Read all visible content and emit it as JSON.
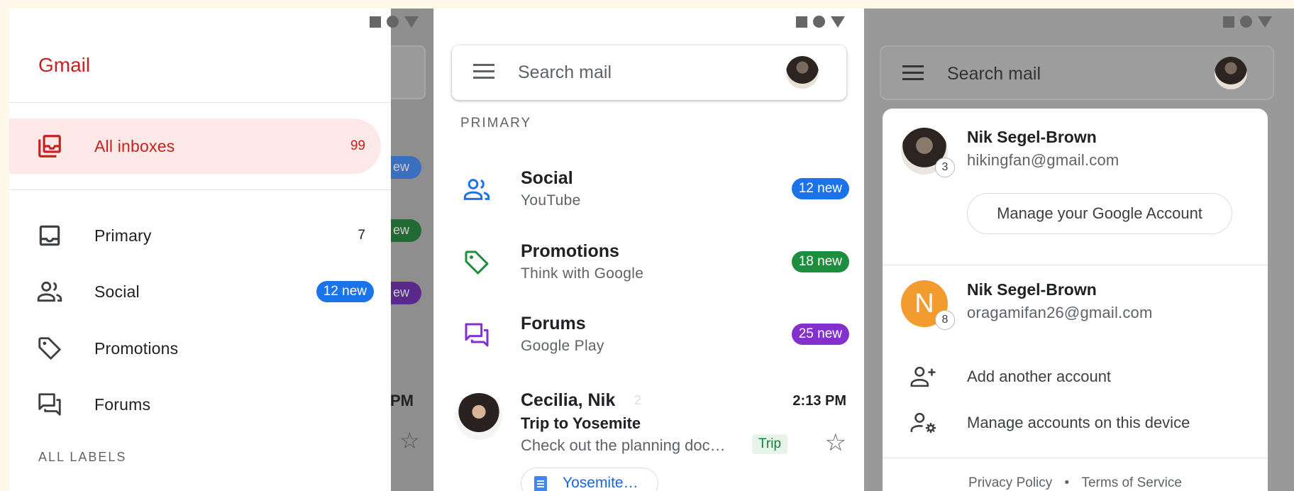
{
  "drawer": {
    "brand": "Gmail",
    "items": [
      {
        "label": "All inboxes",
        "count": "99"
      },
      {
        "label": "Primary",
        "count": "7"
      },
      {
        "label": "Social",
        "badge": "12 new"
      },
      {
        "label": "Promotions"
      },
      {
        "label": "Forums"
      }
    ],
    "all_labels": "ALL LABELS",
    "background_fragments": {
      "badge1": "ew",
      "badge2": "ew",
      "badge3": "ew",
      "time": "PM"
    }
  },
  "inbox": {
    "search_placeholder": "Search mail",
    "section": "PRIMARY",
    "categories": [
      {
        "title": "Social",
        "subtitle": "YouTube",
        "badge": "12 new",
        "color": "#1a73e8"
      },
      {
        "title": "Promotions",
        "subtitle": "Think with Google",
        "badge": "18 new",
        "color": "#1e8e3e"
      },
      {
        "title": "Forums",
        "subtitle": "Google Play",
        "badge": "25 new",
        "color": "#8430ce"
      }
    ],
    "message": {
      "sender": "Cecilia, Nik",
      "thread_count": "2",
      "time": "2:13 PM",
      "subject": "Trip to Yosemite",
      "snippet": "Check out the planning doc…",
      "label": "Trip",
      "attachment": "Yosemite…"
    }
  },
  "accounts": {
    "search_placeholder": "Search mail",
    "list": [
      {
        "name": "Nik Segel-Brown",
        "email": "hikingfan@gmail.com",
        "count": "3"
      },
      {
        "name": "Nik Segel-Brown",
        "email": "oragamifan26@gmail.com",
        "count": "8",
        "initial": "N"
      }
    ],
    "manage_button": "Manage your Google Account",
    "actions": [
      "Add another account",
      "Manage accounts on this device"
    ],
    "footer": {
      "privacy": "Privacy Policy",
      "separator": "•",
      "terms": "Terms of Service"
    }
  },
  "colors": {
    "accent_red": "#c5221f",
    "active_bg": "#fce8e6",
    "social_blue": "#1a73e8",
    "promo_green": "#1e8e3e",
    "forums_purple": "#8430ce"
  }
}
